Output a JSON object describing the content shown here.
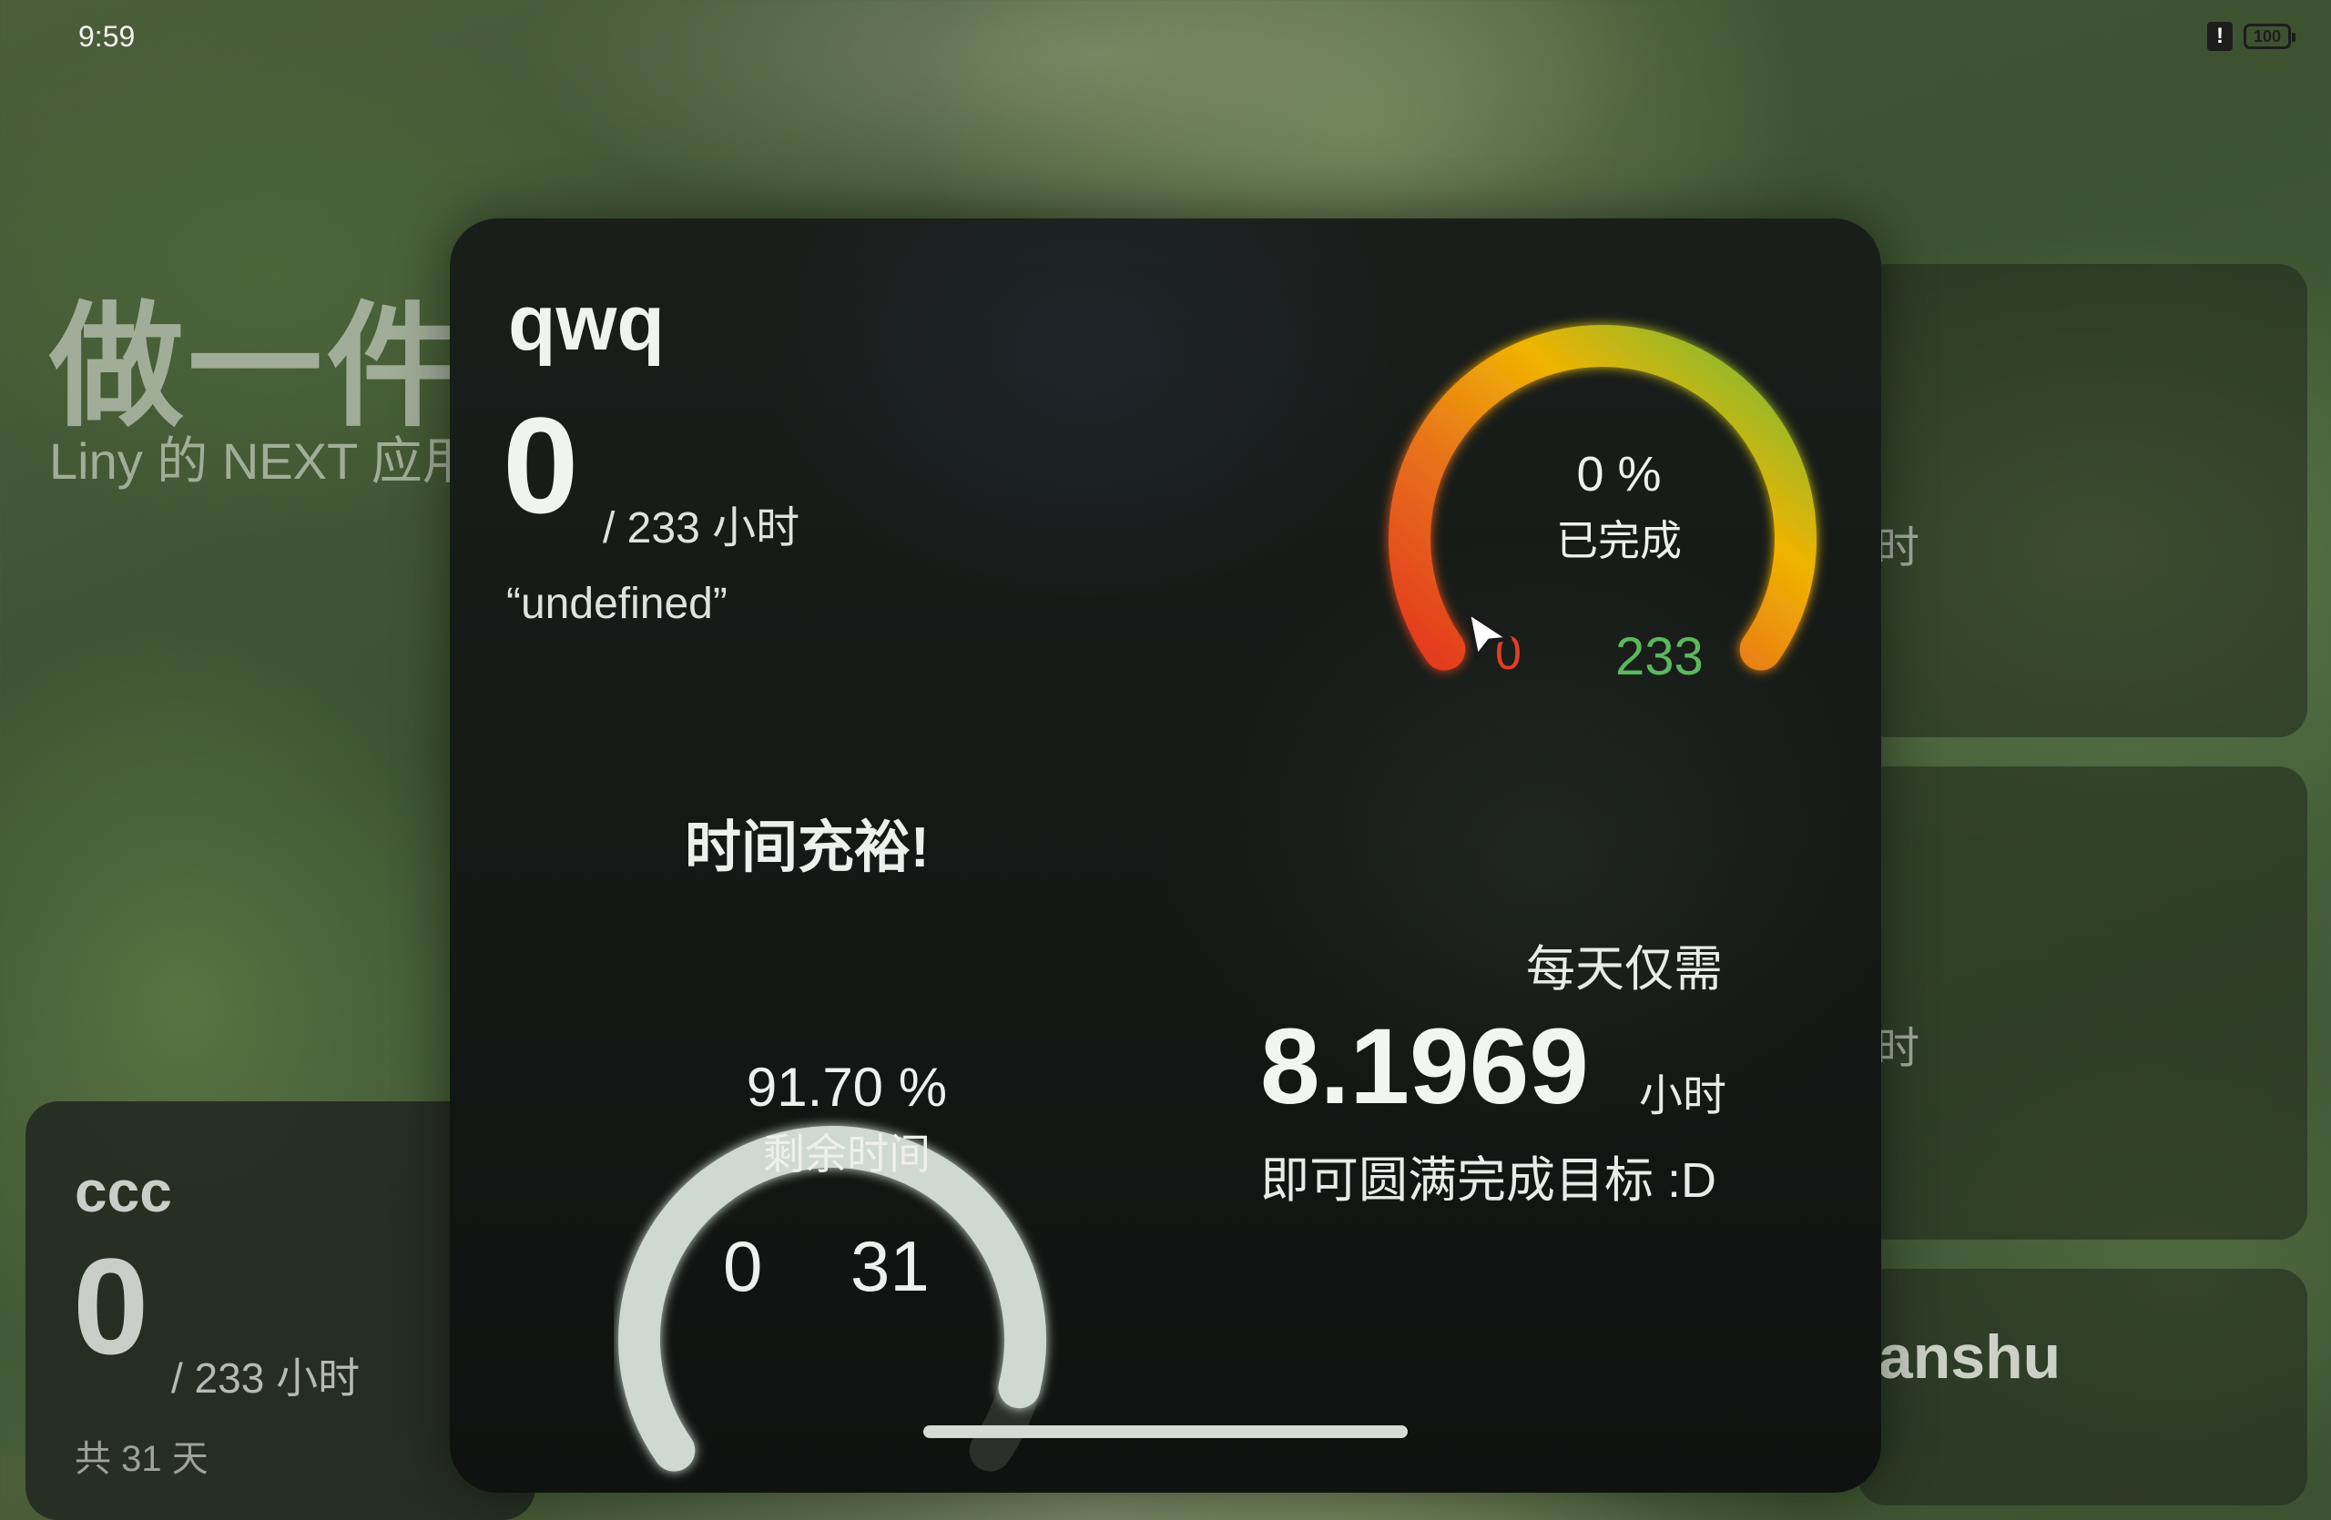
{
  "status_bar": {
    "time": "9:59",
    "battery": "100",
    "alert_glyph": "!"
  },
  "background": {
    "title": "做一件事",
    "subtitle": "Liny 的 NEXT 应用"
  },
  "side_cards": [
    {
      "unit_fragment": "时"
    },
    {
      "unit_fragment": "时"
    },
    {
      "name_fragment": "ianshu"
    }
  ],
  "bottom_left_card": {
    "name": "ccc",
    "value": "0",
    "unit": "/ 233 小时",
    "days": "共 31 天"
  },
  "goal_card": {
    "name": "qwq",
    "value": "0",
    "unit": "/ 233 小时",
    "quote": "“undefined”",
    "progress_gauge": {
      "percent_text": "0 %",
      "label": "已完成",
      "min": "0",
      "max": "233",
      "progress": 0.0,
      "colors": {
        "start": "#e33a20",
        "mid": "#f0b400",
        "end": "#6dbb3c"
      }
    },
    "time_status": "时间充裕!",
    "time_gauge": {
      "percent_text": "91.70 %",
      "label": "剩余时间",
      "min": "0",
      "max": "31",
      "remaining_fraction": 0.917,
      "color": "#cfd9d3"
    },
    "daily": {
      "label": "每天仅需",
      "value": "8.1969",
      "unit": "小时",
      "footer": "即可圆满完成目标 :D"
    }
  }
}
